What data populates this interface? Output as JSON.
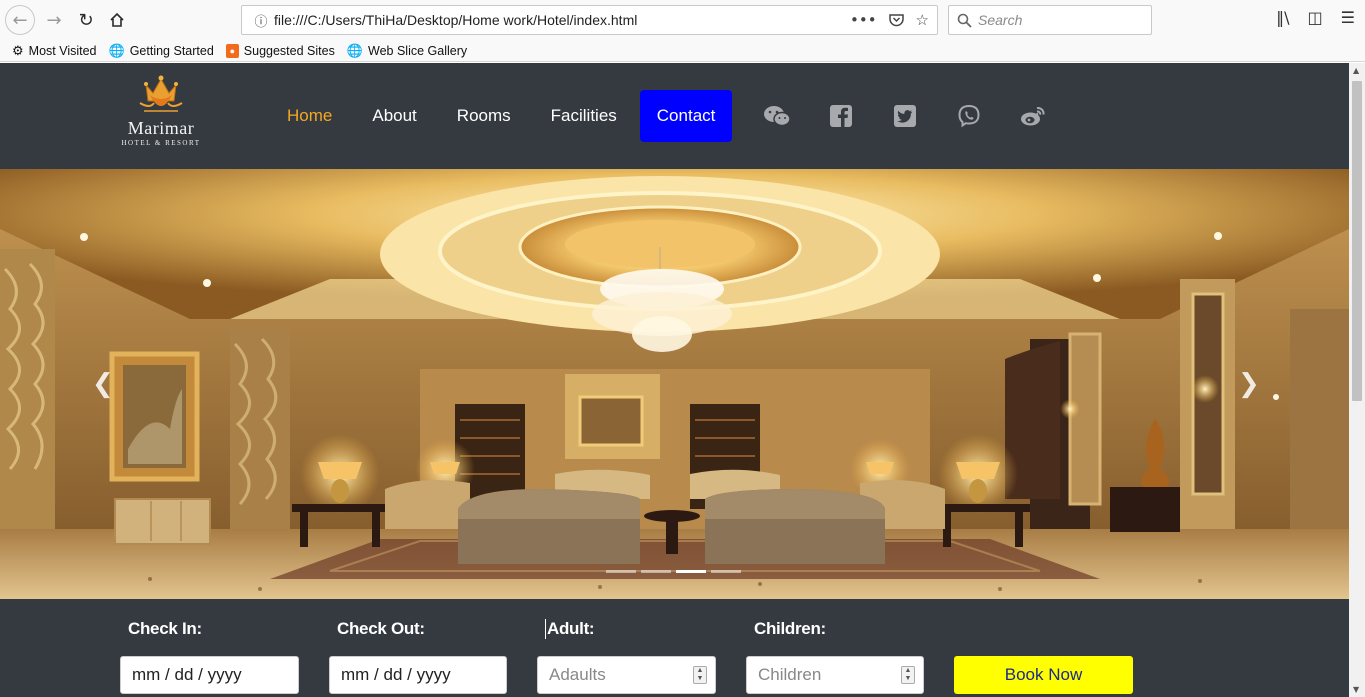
{
  "browser": {
    "url": "file:///C:/Users/ThiHa/Desktop/Home work/Hotel/index.html",
    "search_placeholder": "Search",
    "bookmarks": [
      {
        "label": "Most Visited",
        "icon": "gear-icon"
      },
      {
        "label": "Getting Started",
        "icon": "globe-icon"
      },
      {
        "label": "Suggested Sites",
        "icon": "suggested-sites-icon"
      },
      {
        "label": "Web Slice Gallery",
        "icon": "globe-icon"
      }
    ]
  },
  "site": {
    "logo": {
      "name": "Marimar",
      "subtitle": "HOTEL & RESORT",
      "monogram": "M"
    },
    "nav": [
      {
        "label": "Home",
        "active": true
      },
      {
        "label": "About"
      },
      {
        "label": "Rooms"
      },
      {
        "label": "Facilities"
      },
      {
        "label": "Contact"
      }
    ],
    "social": [
      "wechat-icon",
      "facebook-icon",
      "twitter-icon",
      "viber-icon",
      "weibo-icon"
    ],
    "carousel": {
      "slide_count": 4,
      "active_slide": 3
    },
    "booking": {
      "check_in_label": "Check In:",
      "check_out_label": "Check Out:",
      "adult_label": "Adult:",
      "children_label": "Children:",
      "check_in_value": "mm / dd / yyyy",
      "check_out_value": "mm / dd / yyyy",
      "adults_placeholder": "Adaults",
      "children_placeholder": "Children",
      "book_button": "Book Now"
    },
    "colors": {
      "header_bg": "#343a40",
      "active_nav": "#f5a623",
      "contact_bg": "#0000ff",
      "book_btn": "#ffff00"
    }
  }
}
